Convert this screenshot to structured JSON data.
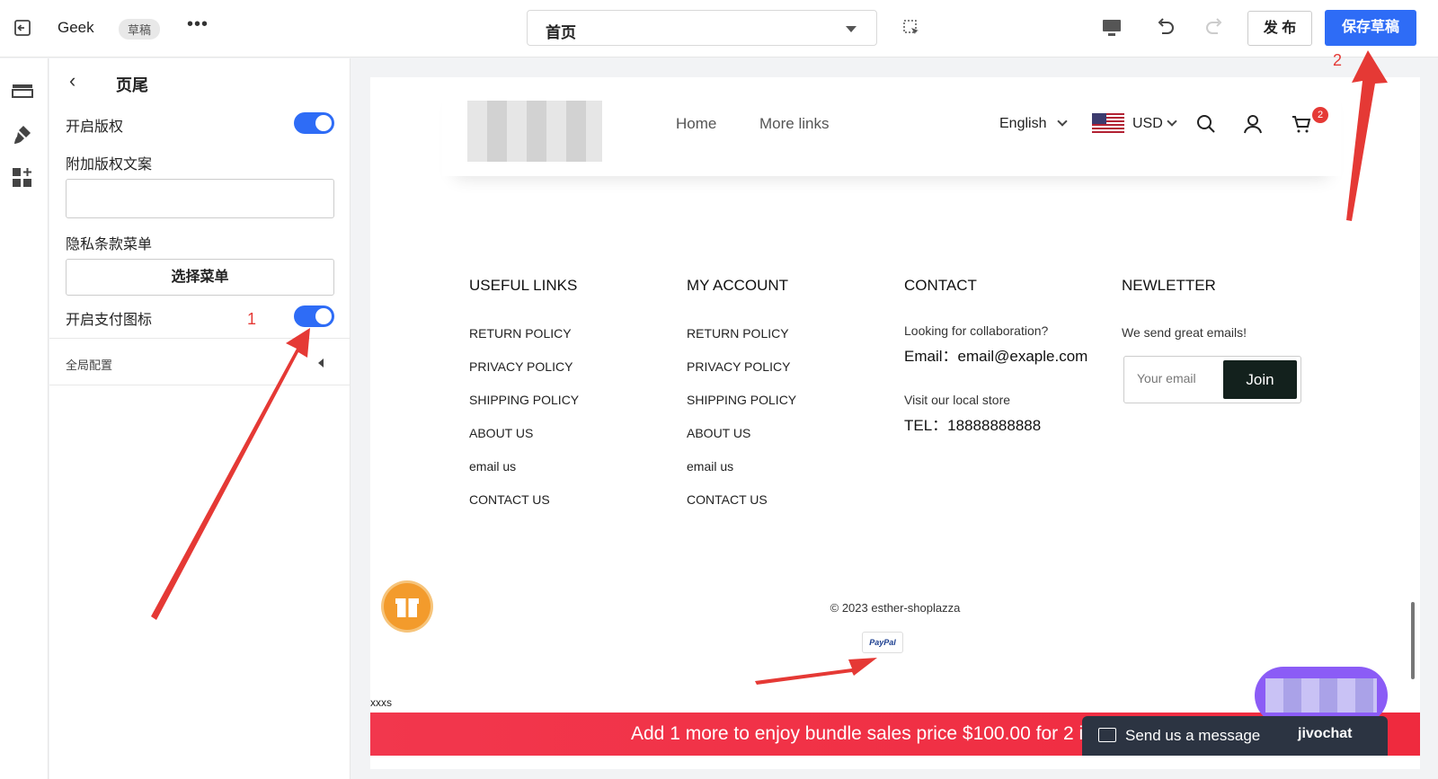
{
  "topbar": {
    "app_name": "Geek",
    "status_badge": "草稿",
    "more": "•••",
    "page_select": "首页",
    "publish_label": "发 布",
    "save_label": "保存草稿"
  },
  "panel": {
    "title": "页尾",
    "copyright_toggle_label": "开启版权",
    "copyright_toggle_on": true,
    "extra_copyright_label": "附加版权文案",
    "extra_copyright_value": "",
    "privacy_menu_label": "隐私条款菜单",
    "select_menu_button": "选择菜单",
    "payment_icon_toggle_label": "开启支付图标",
    "payment_icon_toggle_on": true,
    "global_config_label": "全局配置"
  },
  "annotations": {
    "step1": "1",
    "step2": "2",
    "arrow_color": "#e53935"
  },
  "preview": {
    "nav": [
      "Home",
      "More links"
    ],
    "language": "English",
    "currency": "USD",
    "cart_count": "2",
    "columns": [
      {
        "title": "USEFUL LINKS",
        "links": [
          "RETURN POLICY",
          "PRIVACY POLICY",
          "SHIPPING POLICY",
          "ABOUT US",
          "email us",
          "CONTACT US"
        ]
      },
      {
        "title": "MY ACCOUNT",
        "links": [
          "RETURN POLICY",
          "PRIVACY POLICY",
          "SHIPPING POLICY",
          "ABOUT US",
          "email us",
          "CONTACT US"
        ]
      }
    ],
    "contact": {
      "title": "CONTACT",
      "line1": "Looking for collaboration?",
      "email": "Email：email@exaple.com",
      "line2": "Visit our local store",
      "tel": "TEL：18888888888"
    },
    "newsletter": {
      "title": "NEWLETTER",
      "text": "We send great emails!",
      "placeholder": "Your email",
      "button": "Join"
    },
    "copyright": "© 2023 esther-shoplazza",
    "payment_icon": "PayPal",
    "extra_text": "xxxs",
    "promo_bar": "Add 1 more to enjoy bundle sales price $100.00 for 2 items",
    "chat": {
      "message": "Send us a message",
      "brand": "jivochat"
    }
  },
  "colors": {
    "primary": "#2e6cf6",
    "promo": "#f2374d",
    "join_button": "#13211d",
    "gift": "#f39b2c",
    "chat_bubble": "#8b5cf6"
  }
}
